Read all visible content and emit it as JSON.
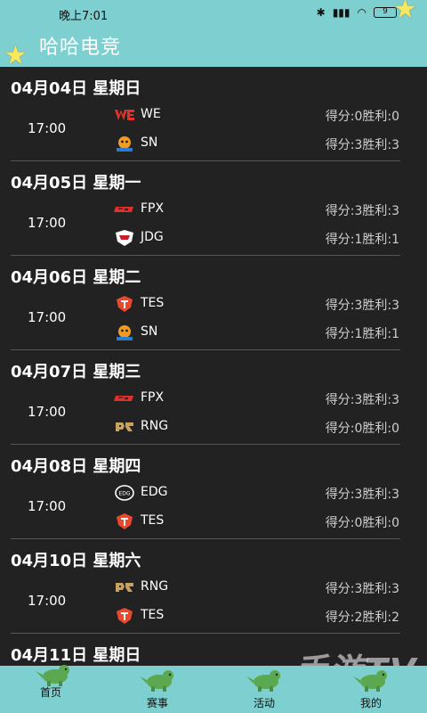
{
  "status_bar": {
    "time": "晚上7:01",
    "battery": "9"
  },
  "header": {
    "title": "哈哈电竞"
  },
  "days": [
    {
      "date": "04月04日",
      "weekday": "星期日",
      "time": "17:00",
      "teams": [
        {
          "name": "WE",
          "score": "得分:0胜利:0",
          "logo": "we-logo"
        },
        {
          "name": "SN",
          "score": "得分:3胜利:3",
          "logo": "sn-logo"
        }
      ]
    },
    {
      "date": "04月05日",
      "weekday": "星期一",
      "time": "17:00",
      "teams": [
        {
          "name": "FPX",
          "score": "得分:3胜利:3",
          "logo": "fpx-logo"
        },
        {
          "name": "JDG",
          "score": "得分:1胜利:1",
          "logo": "jdg-logo"
        }
      ]
    },
    {
      "date": "04月06日",
      "weekday": "星期二",
      "time": "17:00",
      "teams": [
        {
          "name": "TES",
          "score": "得分:3胜利:3",
          "logo": "tes-logo"
        },
        {
          "name": "SN",
          "score": "得分:1胜利:1",
          "logo": "sn-logo"
        }
      ]
    },
    {
      "date": "04月07日",
      "weekday": "星期三",
      "time": "17:00",
      "teams": [
        {
          "name": "FPX",
          "score": "得分:3胜利:3",
          "logo": "fpx-logo"
        },
        {
          "name": "RNG",
          "score": "得分:0胜利:0",
          "logo": "rng-logo"
        }
      ]
    },
    {
      "date": "04月08日",
      "weekday": "星期四",
      "time": "17:00",
      "teams": [
        {
          "name": "EDG",
          "score": "得分:3胜利:3",
          "logo": "edg-logo"
        },
        {
          "name": "TES",
          "score": "得分:0胜利:0",
          "logo": "tes-logo"
        }
      ]
    },
    {
      "date": "04月10日",
      "weekday": "星期六",
      "time": "17:00",
      "teams": [
        {
          "name": "RNG",
          "score": "得分:3胜利:3",
          "logo": "rng-logo"
        },
        {
          "name": "TES",
          "score": "得分:2胜利:2",
          "logo": "tes-logo"
        }
      ]
    },
    {
      "date": "04月11日",
      "weekday": "星期日"
    }
  ],
  "bottom_nav": [
    {
      "label": "首页",
      "icon": "dinosaur-icon"
    },
    {
      "label": "赛事",
      "icon": "dinosaur-bike-icon"
    },
    {
      "label": "活动",
      "icon": "dinosaur-car-icon"
    },
    {
      "label": "我的",
      "icon": "dinosaur-icon"
    }
  ],
  "colors": {
    "accent": "#7ecfd0",
    "background": "#222222",
    "star": "#f6e85a"
  }
}
